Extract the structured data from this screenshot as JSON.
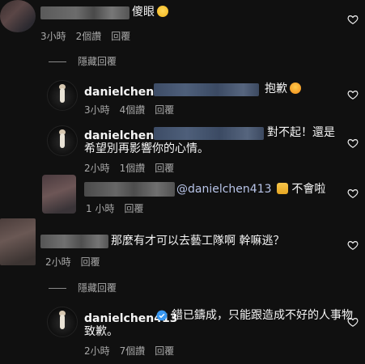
{
  "c1": {
    "text": "傻眼",
    "time": "3小時",
    "likes": "2個讚",
    "reply": "回覆"
  },
  "hide1": {
    "label": "隱藏回覆"
  },
  "r1": {
    "name": "danielchen413",
    "text": "抱歉",
    "time": "3小時",
    "likes": "4個讚",
    "reply": "回覆"
  },
  "r2": {
    "name": "danielchen413",
    "text_a": "對不起！還是",
    "text_b": "希望別再影響你的心情。",
    "time": "2小時",
    "likes": "1個讚",
    "reply": "回覆"
  },
  "c2": {
    "mention": "@danielchen413",
    "text": "不會啦",
    "time": "1 小時",
    "reply": "回覆"
  },
  "c3": {
    "text": "那麼有才可以去藝工隊啊 幹嘛逃？",
    "time": "2小時",
    "reply": "回覆"
  },
  "hide2": {
    "label": "隱藏回覆"
  },
  "r3": {
    "name": "danielchen413",
    "text_a": "錯已鑄成，只能跟造成不好的人事物",
    "text_b": "致歉。",
    "time": "2小時",
    "likes": "7個讚",
    "reply": "回覆"
  },
  "colors": {
    "bg": "#101010",
    "meta": "#a8a8a8",
    "mention": "#b8c4e8",
    "verified": "#3897f0"
  },
  "icons": {
    "like": "heart-outline-icon",
    "verified": "verified-badge-icon"
  }
}
